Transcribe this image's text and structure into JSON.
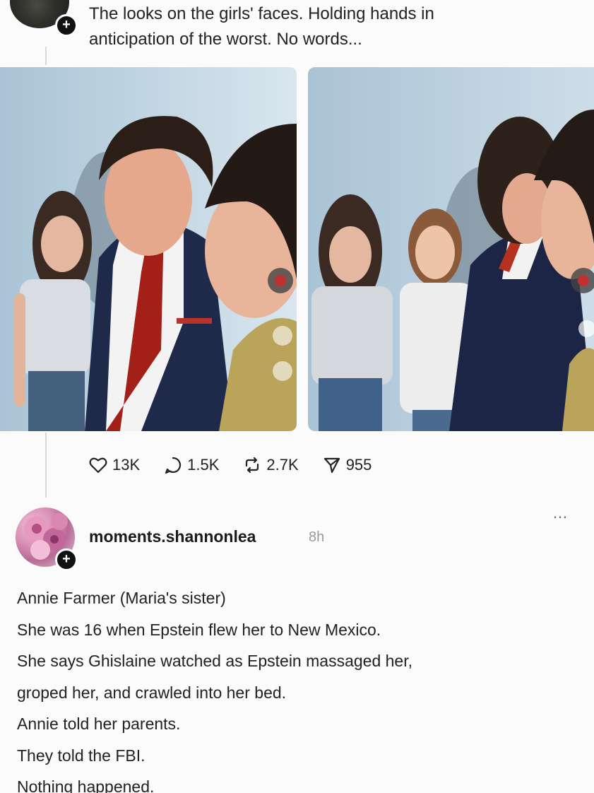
{
  "post": {
    "caption_line1": "The looks on the girls' faces. Holding hands in",
    "caption_line2": "anticipation of the worst. No words...",
    "images": [
      {
        "icon": "photo-left"
      },
      {
        "icon": "photo-right"
      }
    ],
    "actions": {
      "likes": "13K",
      "comments": "1.5K",
      "reposts": "2.7K",
      "shares": "955"
    },
    "author_avatar_icon": "avatar-icon",
    "follow_icon": "plus-icon"
  },
  "reply": {
    "username": "moments.shannonlea",
    "time": "8h",
    "more_label": "…",
    "lines": [
      "Annie Farmer (Maria's sister)",
      "She was 16 when Epstein flew her to New Mexico.",
      "She says Ghislaine watched as Epstein massaged her,",
      "groped her, and crawled into her bed.",
      "Annie told her parents.",
      "They told the FBI.",
      "Nothing happened."
    ]
  },
  "colors": {
    "background": "#fbfbfb",
    "text": "#222222",
    "muted": "#9a9a9a",
    "thread_line": "#d8d8d8"
  }
}
